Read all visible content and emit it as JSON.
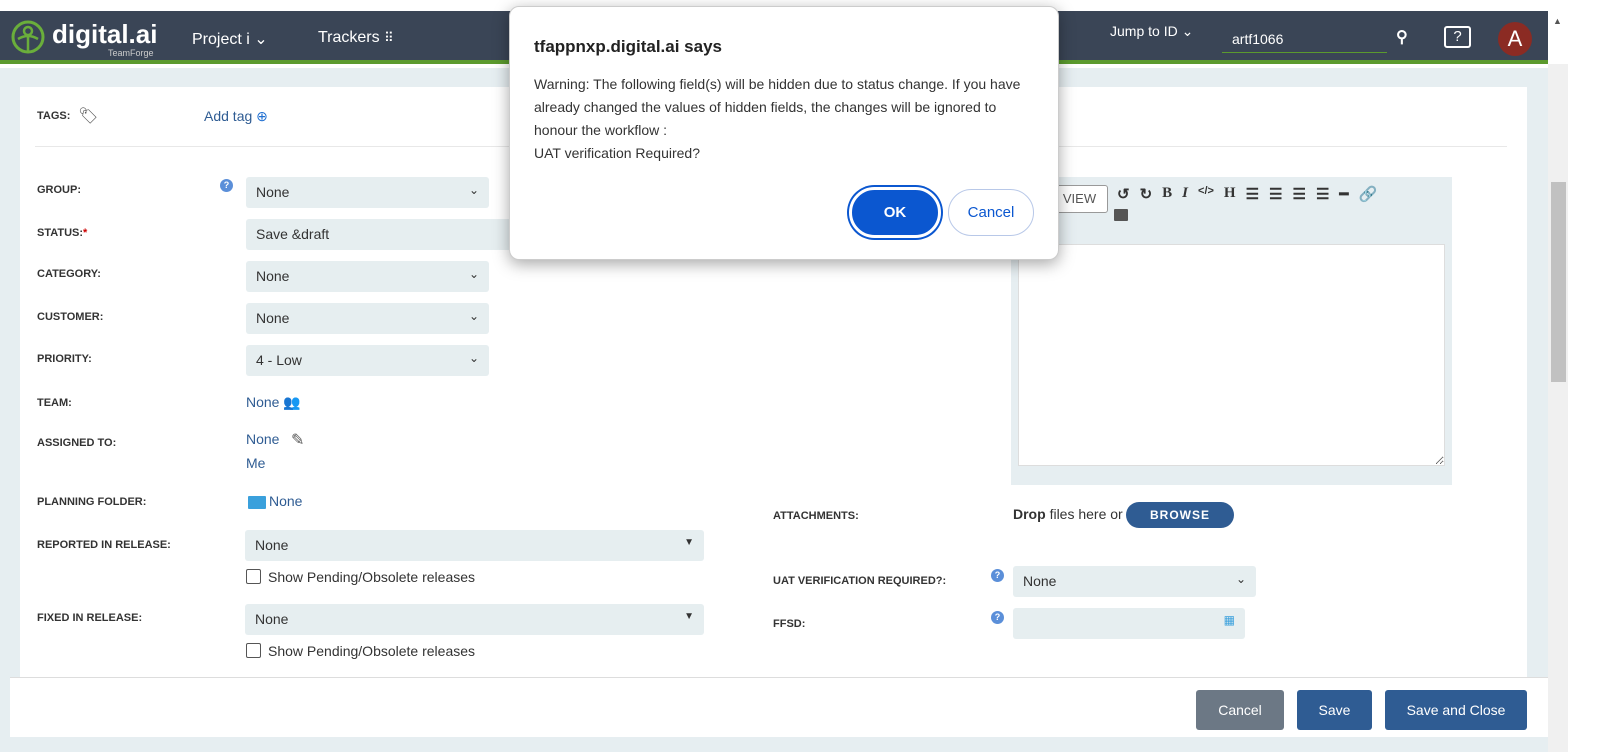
{
  "header": {
    "logo": "digital.ai",
    "logo_sub": "TeamForge",
    "project": "Project i",
    "trackers": "Trackers",
    "jump_to_id": "Jump to ID",
    "jump_value": "artf1066",
    "avatar": "A",
    "help": "?"
  },
  "colors": {
    "header": "#3a4556",
    "accent_green": "#5b9a2e",
    "primary": "#2f5c93",
    "dialog_ok": "#0b57d0",
    "avatar": "#8b2b23"
  },
  "form": {
    "tags_label": "TAGS:",
    "add_tag": "Add tag",
    "group": {
      "label": "GROUP:",
      "value": "None"
    },
    "status": {
      "label": "STATUS:",
      "required": "*",
      "value": "Save &draft"
    },
    "category": {
      "label": "CATEGORY:",
      "value": "None"
    },
    "customer": {
      "label": "CUSTOMER:",
      "value": "None"
    },
    "priority": {
      "label": "PRIORITY:",
      "value": "4 - Low"
    },
    "team": {
      "label": "TEAM:",
      "value": "None"
    },
    "assigned": {
      "label": "ASSIGNED TO:",
      "value": "None",
      "me": "Me"
    },
    "planning": {
      "label": "PLANNING FOLDER:",
      "value": "None"
    },
    "reported": {
      "label": "REPORTED IN RELEASE:",
      "value": "None",
      "checkbox": "Show Pending/Obsolete releases"
    },
    "fixed": {
      "label": "FIXED IN RELEASE:",
      "value": "None",
      "checkbox": "Show Pending/Obsolete releases"
    },
    "attachments": {
      "label": "ATTACHMENTS:",
      "drop": "Drop",
      "files_here": "files here or",
      "browse": "BROWSE"
    },
    "uat": {
      "label": "UAT VERIFICATION REQUIRED?:",
      "value": "None"
    },
    "ffsd": {
      "label": "FFSD:",
      "value": ""
    },
    "editor": {
      "preview": "VIEW"
    }
  },
  "footer": {
    "cancel": "Cancel",
    "save": "Save",
    "save_close": "Save and Close"
  },
  "dialog": {
    "title": "tfappnxp.digital.ai says",
    "message": "Warning: The following field(s) will be hidden due to status change. If you have already changed the values of hidden fields, the changes will be ignored to honour the workflow :",
    "field": "UAT verification Required?",
    "ok": "OK",
    "cancel": "Cancel"
  }
}
